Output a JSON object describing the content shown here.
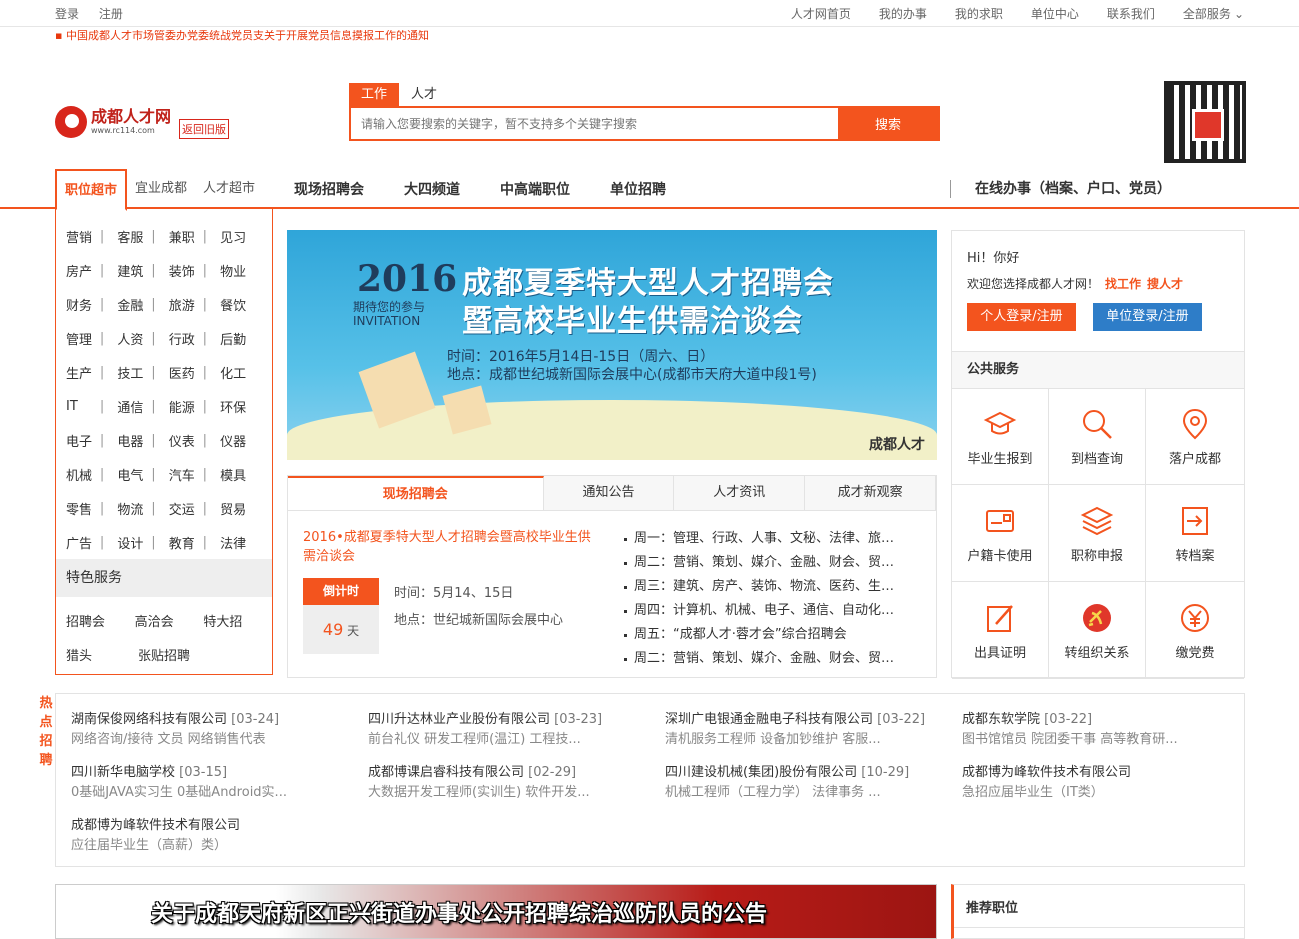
{
  "topbar": {
    "left": [
      "登录",
      "注册"
    ],
    "right": [
      "人才网首页",
      "我的办事",
      "我的求职",
      "单位中心",
      "联系我们",
      "全部服务"
    ]
  },
  "ticker": [
    "中国成都人才市场管委办党委统战党员支关于开展党员信息摸报工作的通知"
  ],
  "logo": {
    "cn": "成都人才网",
    "en": "www.rc114.com",
    "old_version": "返回旧版"
  },
  "search": {
    "tabs": [
      "工作",
      "人才"
    ],
    "placeholder": "请输入您要搜索的关键字，暂不支持多个关键字搜索",
    "button": "搜索"
  },
  "nav": {
    "side_tabs": [
      "职位超市",
      "宜业成都",
      "人才超市"
    ],
    "main": [
      "现场招聘会",
      "大四频道",
      "中高端职位",
      "单位招聘"
    ],
    "online": "在线办事（档案、户口、党员）"
  },
  "sidebar": {
    "categories": [
      [
        "营销",
        "客服",
        "兼职",
        "见习"
      ],
      [
        "房产",
        "建筑",
        "装饰",
        "物业"
      ],
      [
        "财务",
        "金融",
        "旅游",
        "餐饮"
      ],
      [
        "管理",
        "人资",
        "行政",
        "后勤"
      ],
      [
        "生产",
        "技工",
        "医药",
        "化工"
      ],
      [
        "IT",
        "通信",
        "能源",
        "环保"
      ],
      [
        "电子",
        "电器",
        "仪表",
        "仪器"
      ],
      [
        "机械",
        "电气",
        "汽车",
        "模具"
      ],
      [
        "零售",
        "物流",
        "交运",
        "贸易"
      ],
      [
        "广告",
        "设计",
        "教育",
        "法律"
      ]
    ],
    "special_title": "特色服务",
    "special": [
      [
        "招聘会",
        "高洽会",
        "特大招"
      ],
      [
        "猎头",
        "张贴招聘"
      ]
    ]
  },
  "banner": {
    "year": "2016",
    "title1": "成都夏季特大型人才招聘会",
    "title2": "暨高校毕业生供需洽谈会",
    "sub1": "期待您的参与",
    "sub2": "INVITATION",
    "time": "时间：2016年5月14日-15日（周六、日）",
    "place": "地点：成都世纪城新国际会展中心(成都市天府大道中段1号)",
    "brand": "成都人才"
  },
  "news": {
    "tabs": [
      "现场招聘会",
      "通知公告",
      "人才资讯",
      "成才新观察"
    ],
    "headline": "2016•成都夏季特大型人才招聘会暨高校毕业生供需洽谈会",
    "countdown_label": "倒计时",
    "countdown_value": "49",
    "countdown_unit": "天",
    "time": "时间：5月14、15日",
    "place": "地点：世纪城新国际会展中心",
    "schedule": [
      "周一：管理、行政、人事、文秘、法律、旅…",
      "周二：营销、策划、媒介、金融、财会、贸…",
      "周三：建筑、房产、装饰、物流、医药、生…",
      "周四：计算机、机械、电子、通信、自动化…",
      "周五：“成都人才·蓉才会”综合招聘会",
      "周二：营销、策划、媒介、金融、财会、贸…"
    ]
  },
  "panel": {
    "hi": "Hi！你好",
    "welcome": "欢迎您选择成都人才网！",
    "find_job": "找工作",
    "find_talent": "搜人才",
    "btn_personal": "个人登录/注册",
    "btn_company": "单位登录/注册",
    "public_title": "公共服务",
    "services": [
      "毕业生报到",
      "到档查询",
      "落户成都",
      "户籍卡使用",
      "职称申报",
      "转档案",
      "出具证明",
      "转组织关系",
      "缴党费"
    ]
  },
  "hot": {
    "label": "热点招聘",
    "items": [
      {
        "company": "湖南保俊网络科技有限公司",
        "date": "[03-24]",
        "jobs": "网络咨询/接待 文员 网络销售代表"
      },
      {
        "company": "四川升达林业产业股份有限公司",
        "date": "[03-23]",
        "jobs": "前台礼仪 研发工程师(温江) 工程技..."
      },
      {
        "company": "深圳广电银通金融电子科技有限公司",
        "date": "[03-22]",
        "jobs": "清机服务工程师 设备加钞维护 客服..."
      },
      {
        "company": "成都东软学院",
        "date": "[03-22]",
        "jobs": "图书馆馆员 院团委干事 高等教育研..."
      },
      {
        "company": "四川新华电脑学校",
        "date": "[03-15]",
        "jobs": "0基础JAVA实习生 0基础Android实..."
      },
      {
        "company": "成都博课启睿科技有限公司",
        "date": "[02-29]",
        "jobs": "大数据开发工程师(实训生) 软件开发..."
      },
      {
        "company": "四川建设机械(集团)股份有限公司",
        "date": "[10-29]",
        "jobs": "机械工程师（工程力学） 法律事务 ..."
      },
      {
        "company": "成都博为峰软件技术有限公司",
        "date": "",
        "jobs": "急招应届毕业生（IT类）"
      },
      {
        "company": "成都博为峰软件技术有限公司",
        "date": "",
        "jobs": "应往届毕业生（高薪）类）"
      }
    ]
  },
  "bottom_banner": "关于成都天府新区正兴街道办事处公开招聘综治巡防队员的公告",
  "recommend": "推荐职位"
}
